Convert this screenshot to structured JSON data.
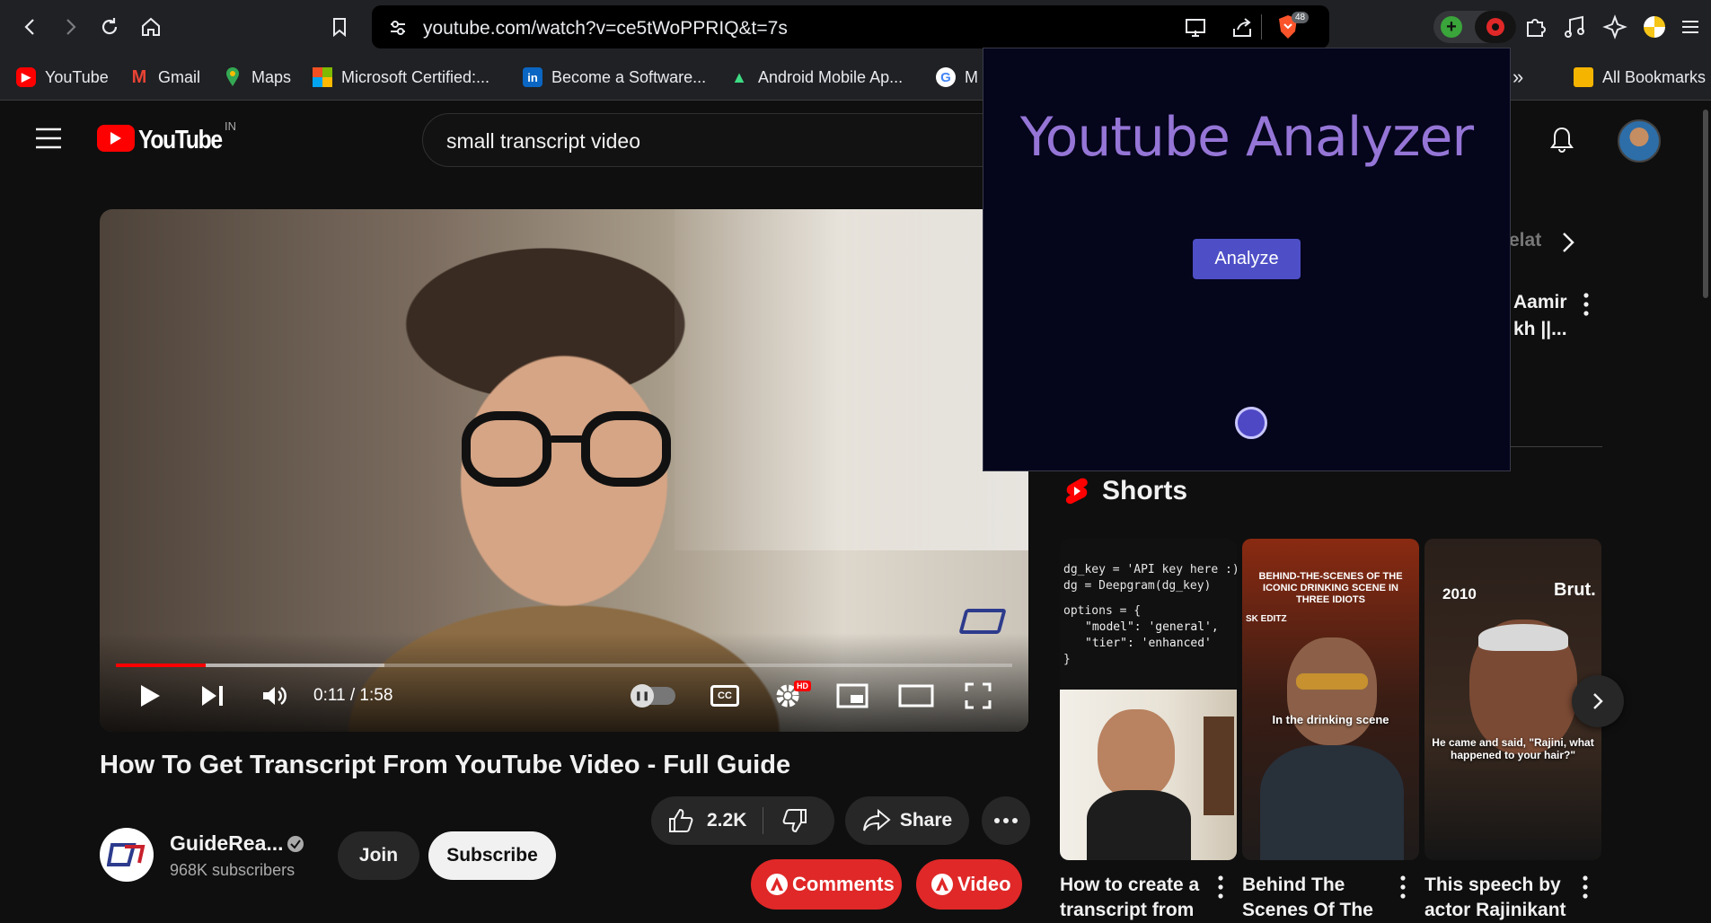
{
  "browser": {
    "url": "youtube.com/watch?v=ce5tWoPPRIQ&t=7s",
    "brave_shield_count": "48",
    "bookmarks": [
      "YouTube",
      "Gmail",
      "Maps",
      "Microsoft Certified:...",
      "Become a Software...",
      "Android Mobile Ap...",
      "M"
    ],
    "all_bookmarks": "All Bookmarks"
  },
  "masthead": {
    "logo": "YouTube",
    "country": "IN",
    "search_query": "small transcript video"
  },
  "player": {
    "time": "0:11 / 1:58",
    "progress": 0.1,
    "buffered": 0.3,
    "hd_badge": "HD"
  },
  "video": {
    "title": "How To Get Transcript From YouTube Video - Full Guide",
    "channel_name": "GuideRea...",
    "subscribers": "968K subscribers",
    "join": "Join",
    "subscribe": "Subscribe",
    "likes": "2.2K",
    "share": "Share",
    "comments_btn": "Comments",
    "video_btn": "Video"
  },
  "sidebar": {
    "chip_partial": "elat",
    "video_title_line1": "Aamir",
    "video_title_line2": "kh ||...",
    "shorts_header": "Shorts",
    "shorts": [
      {
        "title_line1": "How to create a",
        "title_line2": "transcript from",
        "code_line1": "dg_key = 'API key here :)'",
        "code_line2": "dg = Deepgram(dg_key)",
        "code_line3": "options = {",
        "code_line4": "\"model\": 'general',",
        "code_line5": "\"tier\": 'enhanced'",
        "code_line6": "}"
      },
      {
        "title_line1": "Behind The",
        "title_line2": "Scenes Of The",
        "overlay_top": "BEHIND-THE-SCENES OF THE ICONIC DRINKING SCENE IN THREE IDIOTS",
        "tag": "SK EDITZ",
        "overlay_bottom": "In the drinking scene"
      },
      {
        "title_line1": "This speech by",
        "title_line2": "actor Rajinikant",
        "year": "2010",
        "brand": "Brut.",
        "caption": "He came and said, \"Rajini, what happened to your hair?\""
      }
    ]
  },
  "popup": {
    "title": "Youtube Analyzer",
    "analyze": "Analyze"
  },
  "colors": {
    "yt_red": "#ff0000",
    "popup_bg": "#05051c",
    "popup_title": "#9575d6",
    "analyze_btn": "#4e4fc6",
    "red_pill": "#e02828"
  }
}
